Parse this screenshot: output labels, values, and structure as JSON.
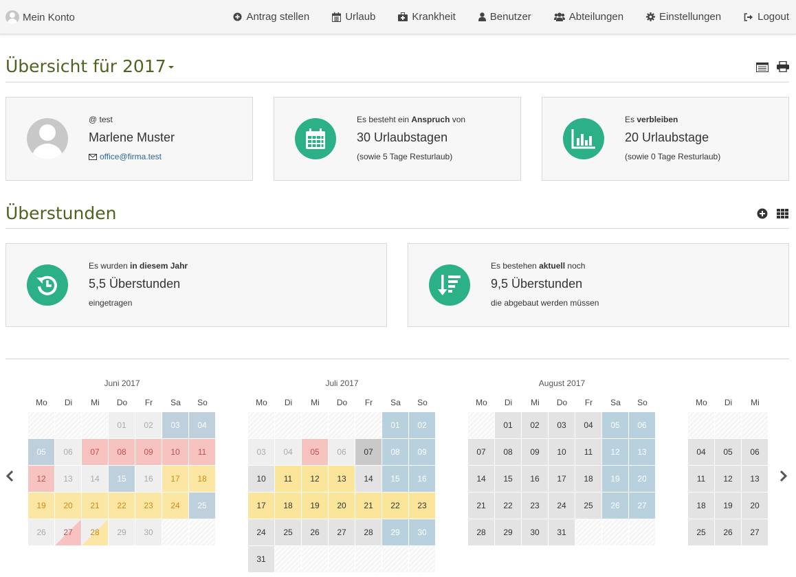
{
  "nav": {
    "brand": "Mein Konto",
    "items": [
      {
        "label": "Antrag stellen",
        "icon": "plus-circle-icon"
      },
      {
        "label": "Urlaub",
        "icon": "calendar-icon"
      },
      {
        "label": "Krankheit",
        "icon": "medkit-icon"
      },
      {
        "label": "Benutzer",
        "icon": "user-icon"
      },
      {
        "label": "Abteilungen",
        "icon": "users-icon"
      },
      {
        "label": "Einstellungen",
        "icon": "gear-icon"
      },
      {
        "label": "Logout",
        "icon": "logout-icon"
      }
    ]
  },
  "overview": {
    "title": "Übersicht für 2017",
    "user": {
      "handle": "@ test",
      "name": "Marlene Muster",
      "email": "office@firma.test"
    },
    "claim": {
      "pre": "Es besteht ein ",
      "bold": "Anspruch",
      "post": " von",
      "value": "30 Urlaubstagen",
      "note": "(sowie 5 Tage Resturlaub)"
    },
    "remaining": {
      "pre": "Es ",
      "bold": "verbleiben",
      "post": "",
      "value": "20 Urlaubstage",
      "note": "(sowie 0 Tage Resturlaub)"
    }
  },
  "overtime": {
    "title": "Überstunden",
    "year": {
      "pre": "Es wurden ",
      "bold": "in diesem Jahr",
      "post": "",
      "value": "5,5 Überstunden",
      "note": "eingetragen"
    },
    "current": {
      "pre": "Es bestehen ",
      "bold": "aktuell",
      "post": " noch",
      "value": "9,5 Überstunden",
      "note": "die abgebaut werden müssen"
    }
  },
  "weekdays": [
    "Mo",
    "Di",
    "Mi",
    "Do",
    "Fr",
    "Sa",
    "So"
  ],
  "colors": {
    "accent": "#2bb088",
    "title": "#4f6320",
    "weekend": "#b9d1df",
    "vacation": "#f7c3c1",
    "sick": "#fbe7a3"
  },
  "calendars": [
    {
      "title": "Juni 2017",
      "weeks": [
        [
          [
            "",
            "e"
          ],
          [
            "",
            "e"
          ],
          [
            "",
            "e"
          ],
          [
            "01",
            "off"
          ],
          [
            "02",
            "off"
          ],
          [
            "03",
            "we-dim"
          ],
          [
            "04",
            "we-dim"
          ]
        ],
        [
          [
            "05",
            "we-dim"
          ],
          [
            "06",
            "off"
          ],
          [
            "07",
            "red"
          ],
          [
            "08",
            "red"
          ],
          [
            "09",
            "red"
          ],
          [
            "10",
            "red"
          ],
          [
            "11",
            "red"
          ]
        ],
        [
          [
            "12",
            "red"
          ],
          [
            "13",
            "off"
          ],
          [
            "14",
            "off"
          ],
          [
            "15",
            "we-dim"
          ],
          [
            "16",
            "off"
          ],
          [
            "17",
            "yel"
          ],
          [
            "18",
            "yel"
          ]
        ],
        [
          [
            "19",
            "yel"
          ],
          [
            "20",
            "yel"
          ],
          [
            "21",
            "yel"
          ],
          [
            "22",
            "yel"
          ],
          [
            "23",
            "yel"
          ],
          [
            "24",
            "yel"
          ],
          [
            "25",
            "we-dim"
          ]
        ],
        [
          [
            "26",
            "off"
          ],
          [
            "27",
            "halfred"
          ],
          [
            "28",
            "halfyel"
          ],
          [
            "29",
            "off"
          ],
          [
            "30",
            "off"
          ],
          [
            "",
            "e"
          ],
          [
            "",
            "e"
          ]
        ]
      ]
    },
    {
      "title": "Juli 2017",
      "weeks": [
        [
          [
            "",
            "e"
          ],
          [
            "",
            "e"
          ],
          [
            "",
            "e"
          ],
          [
            "",
            "e"
          ],
          [
            "",
            "e"
          ],
          [
            "01",
            "we"
          ],
          [
            "02",
            "we"
          ]
        ],
        [
          [
            "03",
            "off"
          ],
          [
            "04",
            "off"
          ],
          [
            "05",
            "red"
          ],
          [
            "06",
            "off"
          ],
          [
            "07",
            "today"
          ],
          [
            "08",
            "we"
          ],
          [
            "09",
            "we"
          ]
        ],
        [
          [
            "10",
            "wd"
          ],
          [
            "11",
            "yel2"
          ],
          [
            "12",
            "yel2"
          ],
          [
            "13",
            "yel2"
          ],
          [
            "14",
            "wd"
          ],
          [
            "15",
            "we"
          ],
          [
            "16",
            "we"
          ]
        ],
        [
          [
            "17",
            "yel2"
          ],
          [
            "18",
            "yel2"
          ],
          [
            "19",
            "yel2"
          ],
          [
            "20",
            "yel2"
          ],
          [
            "21",
            "yel2"
          ],
          [
            "22",
            "yel2"
          ],
          [
            "23",
            "yel2"
          ]
        ],
        [
          [
            "24",
            "wd"
          ],
          [
            "25",
            "wd"
          ],
          [
            "26",
            "wd"
          ],
          [
            "27",
            "wd"
          ],
          [
            "28",
            "wd"
          ],
          [
            "29",
            "we"
          ],
          [
            "30",
            "we"
          ]
        ],
        [
          [
            "31",
            "wd"
          ],
          [
            "",
            "e"
          ],
          [
            "",
            "e"
          ],
          [
            "",
            "e"
          ],
          [
            "",
            "e"
          ],
          [
            "",
            "e"
          ],
          [
            "",
            "e"
          ]
        ]
      ]
    },
    {
      "title": "August 2017",
      "weeks": [
        [
          [
            "",
            "e"
          ],
          [
            "01",
            "wd"
          ],
          [
            "02",
            "wd"
          ],
          [
            "03",
            "wd"
          ],
          [
            "04",
            "wd"
          ],
          [
            "05",
            "we"
          ],
          [
            "06",
            "we"
          ]
        ],
        [
          [
            "07",
            "wd"
          ],
          [
            "08",
            "wd"
          ],
          [
            "09",
            "wd"
          ],
          [
            "10",
            "wd"
          ],
          [
            "11",
            "wd"
          ],
          [
            "12",
            "we"
          ],
          [
            "13",
            "we"
          ]
        ],
        [
          [
            "14",
            "wd"
          ],
          [
            "15",
            "wd"
          ],
          [
            "16",
            "wd"
          ],
          [
            "17",
            "wd"
          ],
          [
            "18",
            "wd"
          ],
          [
            "19",
            "we"
          ],
          [
            "20",
            "we"
          ]
        ],
        [
          [
            "21",
            "wd"
          ],
          [
            "22",
            "wd"
          ],
          [
            "23",
            "wd"
          ],
          [
            "24",
            "wd"
          ],
          [
            "25",
            "wd"
          ],
          [
            "26",
            "we"
          ],
          [
            "27",
            "we"
          ]
        ],
        [
          [
            "28",
            "wd"
          ],
          [
            "29",
            "wd"
          ],
          [
            "30",
            "wd"
          ],
          [
            "31",
            "wd"
          ],
          [
            "",
            "e"
          ],
          [
            "",
            "e"
          ],
          [
            "",
            "e"
          ]
        ]
      ]
    },
    {
      "title": "",
      "weeks": [
        [
          [
            "",
            "e"
          ],
          [
            "",
            "e"
          ],
          [
            "",
            "e"
          ]
        ],
        [
          [
            "04",
            "wd"
          ],
          [
            "05",
            "wd"
          ],
          [
            "06",
            "wd"
          ]
        ],
        [
          [
            "11",
            "wd"
          ],
          [
            "12",
            "wd"
          ],
          [
            "13",
            "wd"
          ]
        ],
        [
          [
            "18",
            "wd"
          ],
          [
            "19",
            "wd"
          ],
          [
            "20",
            "wd"
          ]
        ],
        [
          [
            "25",
            "wd"
          ],
          [
            "26",
            "wd"
          ],
          [
            "27",
            "wd"
          ]
        ]
      ]
    }
  ]
}
